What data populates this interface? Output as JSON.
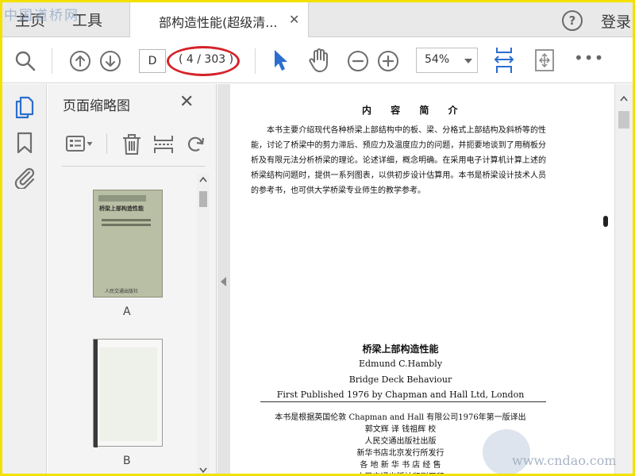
{
  "watermark": {
    "top": "中国道桥网",
    "bottom": "www.cndao.com"
  },
  "tabs": {
    "home": "主页",
    "tools": "工具"
  },
  "document_tab": {
    "title": "部构造性能(超级清...",
    "close": "✕"
  },
  "header_right": {
    "help": "?",
    "login": "登录"
  },
  "toolbar": {
    "page_input": "D",
    "page_count": "( 4 / 303 )",
    "zoom": "54%",
    "more": "•••",
    "accent_color": "#2a6ecf"
  },
  "left_panel": {
    "title": "页面缩略图",
    "close": "✕",
    "thumbnails": [
      {
        "label": "A",
        "cover_lines": [
          "桥梁上部构造性能",
          "人民交通出版社"
        ]
      },
      {
        "label": "B"
      }
    ]
  },
  "document": {
    "heading": "内 容 简 介",
    "paragraph": "本书主要介绍现代各种桥梁上部结构中的板、梁、分格式上部结构及斜桥等的性能，讨论了桥梁中的剪力滞后、预应力及温度应力的问题，并扼要地谈到了用稍板分析及有限元法分析桥梁的理论。论述详细，概念明确。在采用电子计算机计算上述的桥梁结构问题时，提供一系列图表，以供初步设计估算用。本书是桥梁设计技术人员的参考书，也可供大学桥梁专业师生的教学参考。",
    "book_title": "桥梁上部构造性能",
    "author": "Edmund  C.Hambly",
    "english_title": "Bridge  Deck  Behaviour",
    "first_published": "First Published 1976 by Chapman and Hall Ltd, London",
    "translation_note": "本书是根据英国伦敦 Chapman and Hall 有限公司1976年第一版译出",
    "translators": "郭文辉  译     钱祖辉  校",
    "publisher": "人民交通出版社出版",
    "distributor": "新华书店北京发行所发行",
    "sellers": "各 地 新 华 书 店 经 售",
    "printer": "人民交通出版社印刷厂印"
  }
}
